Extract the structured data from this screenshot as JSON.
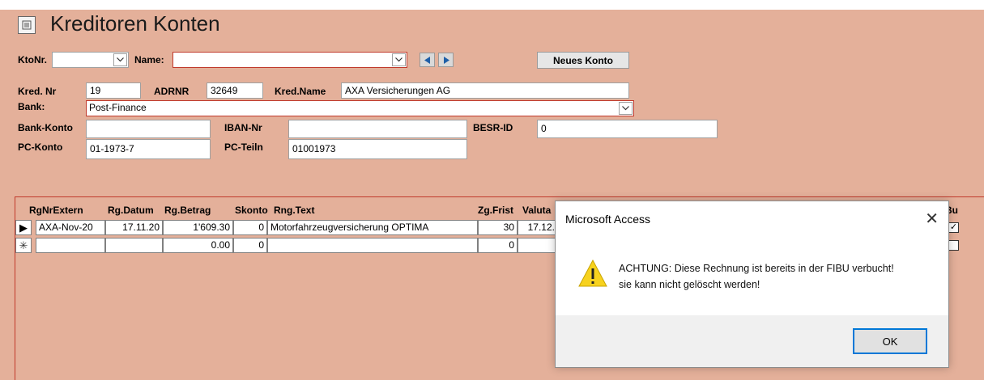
{
  "form": {
    "title": "Kreditoren Konten",
    "icon": "form-icon"
  },
  "search": {
    "kto_label": "KtoNr.",
    "kto_value": "",
    "name_label": "Name:",
    "name_value": "",
    "new_account_button": "Neues Konto"
  },
  "account": {
    "kred_nr_label": "Kred. Nr",
    "kred_nr": "19",
    "adrnr_label": "ADRNR",
    "adrnr": "32649",
    "kred_name_label": "Kred.Name",
    "kred_name": "AXA Versicherungen AG",
    "bank_label": "Bank:",
    "bank": "Post-Finance",
    "bank_konto_label": "Bank-Konto",
    "bank_konto": "",
    "iban_label": "IBAN-Nr",
    "iban": "",
    "besr_label": "BESR-ID",
    "besr": "0",
    "pc_konto_label": "PC-Konto",
    "pc_konto": "01-1973-7",
    "pc_teiln_label": "PC-Teiln",
    "pc_teiln": "01001973"
  },
  "invoices": {
    "headers": [
      "RgNrExtern",
      "Rg.Datum",
      "Rg.Betrag",
      "Skonto",
      "Rng.Text",
      "Zg.Frist",
      "Valuta",
      "Bu"
    ],
    "rows": [
      {
        "rg_nr": "AXA-Nov-20",
        "datum": "17.11.20",
        "betrag": "1'609.30",
        "skonto": "0",
        "text": "Motorfahrzeugversicherung OPTIMA",
        "frist": "30",
        "valuta": "17.12.",
        "selector": "▶",
        "booked": "✓"
      },
      {
        "rg_nr": "",
        "datum": "",
        "betrag": "0.00",
        "skonto": "0",
        "text": "",
        "frist": "0",
        "valuta": "",
        "selector": "✳",
        "booked": ""
      }
    ]
  },
  "dialog": {
    "title": "Microsoft Access",
    "close": "✕",
    "message_line1": "ACHTUNG: Diese Rechnung ist bereits in der FIBU verbucht!",
    "message_line2": "sie kann nicht gelöscht werden!",
    "ok_button": "OK",
    "icon": "warning-icon"
  },
  "colors": {
    "form_background": "#e4b09a",
    "accent_red": "#c0392b",
    "dialog_focus": "#0078d7",
    "warning_yellow": "#f7d21e"
  }
}
